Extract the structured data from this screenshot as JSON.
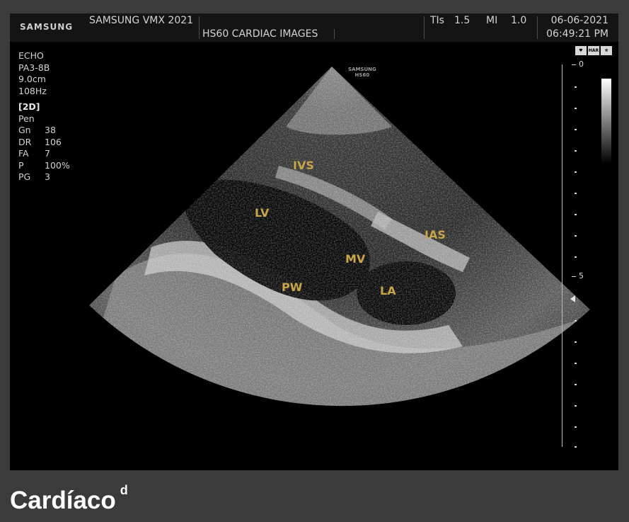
{
  "header": {
    "brand": "SAMSUNG",
    "model": "SAMSUNG VMX 2021",
    "preset": "HS60 CARDIAC IMAGES",
    "tis_label": "TIs",
    "tis_value": "1.5",
    "mi_label": "MI",
    "mi_value": "1.0",
    "date": "06-06-2021",
    "time": "06:49:21 PM"
  },
  "params": {
    "app": "ECHO",
    "probe": "PA3-8B",
    "depth": "9.0cm",
    "frame_rate": "108Hz",
    "mode": "[2D]",
    "harmonic": "Pen",
    "rows": [
      {
        "k": "Gn",
        "v": "38"
      },
      {
        "k": "DR",
        "v": "106"
      },
      {
        "k": "FA",
        "v": "7"
      },
      {
        "k": "P",
        "v": "100%"
      },
      {
        "k": "PG",
        "v": "3"
      }
    ]
  },
  "probe_logo": {
    "line1": "SAMSUNG",
    "line2": "HS60"
  },
  "anatomy_labels": {
    "ivs": "IVS",
    "lv": "LV",
    "ias": "IAS",
    "mv": "MV",
    "pw": "PW",
    "la": "LA"
  },
  "status_icons": [
    "heart-icon",
    "HAR",
    "settings-icon"
  ],
  "status_icon_text": {
    "har": "HAR"
  },
  "depth_scale": {
    "top": "0",
    "mid": "5"
  },
  "caption": {
    "title": "Cardíaco",
    "superscript": "d"
  },
  "colors": {
    "label": "#c9a54a",
    "background": "#3b3b3b",
    "screen": "#000000"
  }
}
